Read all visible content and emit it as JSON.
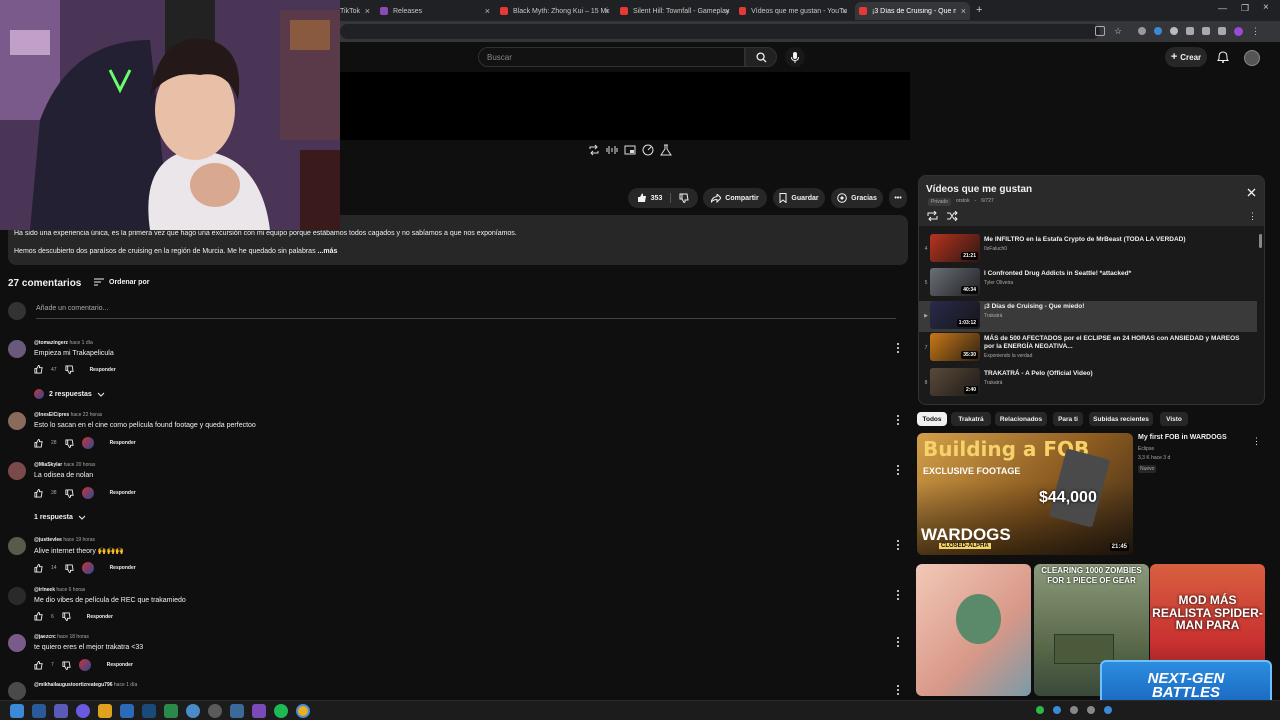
{
  "browser": {
    "tabs": [
      {
        "title": "TikTok",
        "active": false
      },
      {
        "title": "Releases",
        "active": false
      },
      {
        "title": "Black Myth: Zhong Kui – 15 Mi",
        "active": false
      },
      {
        "title": "Silent Hill: Townfall - Gameplay",
        "active": false
      },
      {
        "title": "Vídeos que me gustan - YouTu",
        "active": false
      },
      {
        "title": "¡3 Días de Cruising - Que miedo",
        "active": true
      }
    ],
    "new_tab": "+"
  },
  "header": {
    "search_placeholder": "Buscar",
    "create_label": "Crear"
  },
  "actions": {
    "likes": "353",
    "share": "Compartir",
    "save": "Guardar",
    "thanks": "Gracias"
  },
  "description": {
    "line1": "Ha sido una experiencia única, es la primera vez que hago una excursión con mi equipo porque estábamos todos cagados y no sabíamos a que nos exponíamos.",
    "line2": "Hemos descubierto dos paraísos de cruising en la región de Murcia. Me he quedado sin palabras",
    "more": "...más"
  },
  "comments": {
    "count_label": "27 comentarios",
    "sort_label": "Ordenar por",
    "add_placeholder": "Añade un comentario...",
    "reply_label": "Responder",
    "items": [
      {
        "user": "@tomazingerz",
        "time": "hace 1 día",
        "text": "Empieza mi Trakapelicula",
        "likes": "47",
        "heart": false,
        "replies": "2 respuestas"
      },
      {
        "user": "@InesElCipres",
        "time": "hace 22 horas",
        "text": "Esto lo sacan en el cine como película found footage y queda perfectoo",
        "likes": "28",
        "heart": true,
        "replies": ""
      },
      {
        "user": "@MiaSkylar",
        "time": "hace 20 horas",
        "text": "La odisea de nolan",
        "likes": "38",
        "heart": true,
        "replies": "1 respuesta"
      },
      {
        "user": "@justtevlee",
        "time": "hace 19 horas",
        "text": "Alive internet theory 🙌🙌🙌",
        "likes": "14",
        "heart": true,
        "replies": ""
      },
      {
        "user": "@irlneek",
        "time": "hace 6 horas",
        "text": "Me dio vibes de película de REC que trakamiedo",
        "likes": "6",
        "heart": false,
        "replies": ""
      },
      {
        "user": "@jaezcrc",
        "time": "hace 18 horas",
        "text": "te quiero eres el mejor trakatra <33",
        "likes": "7",
        "heart": true,
        "replies": ""
      },
      {
        "user": "@mikhailaugustoortizreategu796",
        "time": "hace 1 día",
        "text": "",
        "likes": "",
        "heart": false,
        "replies": ""
      }
    ]
  },
  "playlist": {
    "title": "Vídeos que me gustan",
    "privacy": "Privado",
    "owner": "orstok",
    "position": "6/727",
    "items": [
      {
        "num": "4",
        "title": "Me INFILTRO en la Estafa Crypto de MrBeast (TODA LA VERDAD)",
        "channel": "0xFaluch0",
        "duration": "21:21",
        "thumb_color": "#b8341e",
        "current": false
      },
      {
        "num": "5",
        "title": "I Confronted Drug Addicts in Seattle! *attacked*",
        "channel": "Tyler Oliveira",
        "duration": "40:34",
        "thumb_color": "#6a7078",
        "current": false
      },
      {
        "num": "▶",
        "title": "¡3 Días de Cruising - Que miedo!",
        "channel": "Trakatrá",
        "duration": "1:03:12",
        "thumb_color": "#2a2a4a",
        "current": true
      },
      {
        "num": "7",
        "title": "MÁS de 500 AFECTADOS por el ECLIPSE en 24 HORAS con ANSIEDAD y MAREOS por la ENERGÍA NEGATIVA...",
        "channel": "Exponiendo la verdad",
        "duration": "35:30",
        "thumb_color": "#c87818",
        "current": false
      },
      {
        "num": "8",
        "title": "TRAKATRÁ - A Pelo (Official Video)",
        "channel": "Trakatrá",
        "duration": "2:40",
        "thumb_color": "#5a4a3a",
        "current": false
      }
    ]
  },
  "chips": [
    "Todos",
    "Trakatrá",
    "Relacionados",
    "Para ti",
    "Subidas recientes",
    "Visto"
  ],
  "recommended": {
    "title": "My first FOB in WARDOGS",
    "channel": "Eclipse",
    "stats": "3,3 K  hace 3 d",
    "badge": "Nuevo",
    "duration": "21:45",
    "thumb_headline": "Building a FOB",
    "thumb_sub": "EXCLUSIVE FOOTAGE",
    "thumb_price": "$44,000",
    "thumb_brand": "WARDOGS",
    "thumb_brand_sub": "CLOSED-ALPHA"
  },
  "shorts": [
    {
      "caption": "",
      "color": "#e8b0a0"
    },
    {
      "caption": "CLEARING 1000 ZOMBIES FOR 1 PIECE OF GEAR",
      "color": "#5a6a4a"
    },
    {
      "caption": "MOD MÁS REALISTA SPIDER-MAN PARA",
      "color": "#c83030"
    }
  ],
  "sponsor": {
    "line1": "NEXT-GEN",
    "line2": "BATTLES"
  }
}
